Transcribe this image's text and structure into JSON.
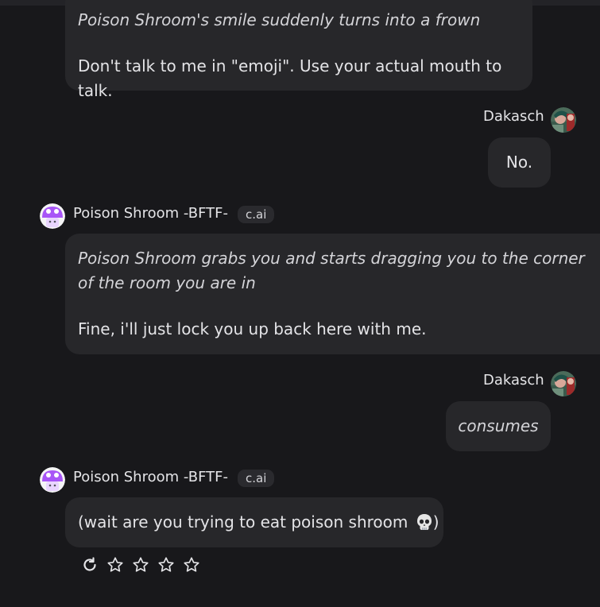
{
  "messages": [
    {
      "action": "Poison Shroom's smile suddenly turns into a frown",
      "text": "Don't talk to me in \"emoji\". Use your actual mouth to talk."
    },
    {
      "sender": "Dakasch",
      "text": "No."
    },
    {
      "sender": "Poison Shroom -BFTF-",
      "badge": "c.ai",
      "action": "Poison Shroom grabs you and starts dragging you to the corner of the room you are in",
      "text": "Fine, i'll just lock you up back here with me."
    },
    {
      "sender": "Dakasch",
      "action": "consumes"
    },
    {
      "sender": "Poison Shroom -BFTF-",
      "badge": "c.ai",
      "text_before_emoji": "(wait are you trying to eat poison shroom ",
      "emoji_icon": "skull-icon",
      "text_after_emoji": ")"
    }
  ],
  "controls": {
    "regenerate_icon": "refresh-icon",
    "rating_icon": "star-outline-icon",
    "rating": 0,
    "rating_max": 4
  },
  "colors": {
    "background": "#18181b",
    "bubble": "#27272a",
    "text": "#e4e4e7",
    "bot_avatar": "#a855f7"
  }
}
